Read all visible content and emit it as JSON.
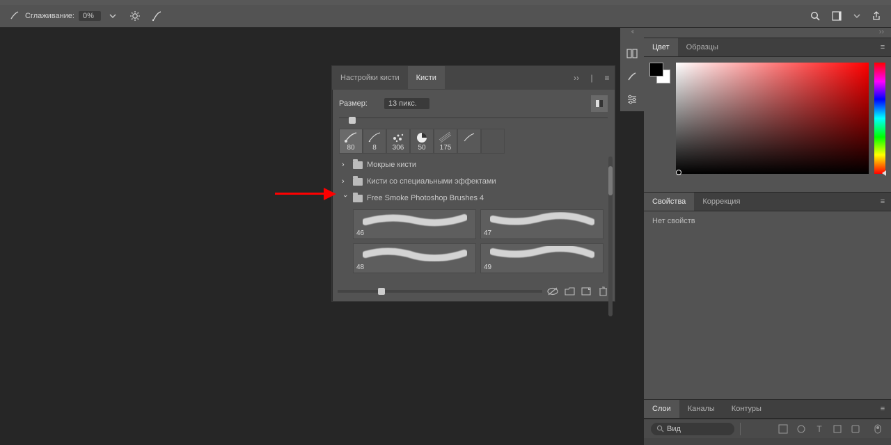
{
  "optbar": {
    "smoothing_label": "Сглаживание:",
    "smoothing_value": "0%"
  },
  "brush_panel": {
    "tab_settings": "Настройки кисти",
    "tab_brushes": "Кисти",
    "size_label": "Размер:",
    "size_value": "13 пикс.",
    "presets": [
      {
        "size": "80"
      },
      {
        "size": "8"
      },
      {
        "size": "306"
      },
      {
        "size": "50"
      },
      {
        "size": "175"
      },
      {
        "size": ""
      }
    ],
    "folders": [
      {
        "name": "Мокрые кисти",
        "open": false
      },
      {
        "name": "Кисти со специальными эффектами",
        "open": false
      },
      {
        "name": "Free Smoke Photoshop Brushes 4",
        "open": true,
        "items": [
          {
            "n": "46"
          },
          {
            "n": "47"
          },
          {
            "n": "48"
          },
          {
            "n": "49"
          }
        ]
      }
    ]
  },
  "right_panels": {
    "color": {
      "tab_color": "Цвет",
      "tab_swatches": "Образцы"
    },
    "properties": {
      "tab_props": "Свойства",
      "tab_adjust": "Коррекция",
      "body": "Нет свойств"
    },
    "layers": {
      "tab_layers": "Слои",
      "tab_channels": "Каналы",
      "tab_paths": "Контуры",
      "search_placeholder": "Вид"
    }
  },
  "colors": {
    "fg": "#000000",
    "bg": "#ffffff"
  }
}
